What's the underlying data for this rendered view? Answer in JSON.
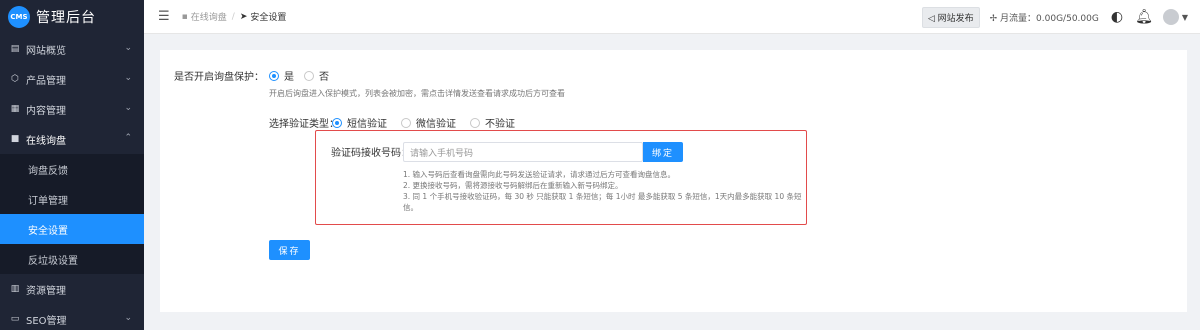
{
  "app": {
    "logo_badge": "CMS",
    "title": "管理后台"
  },
  "sidebar": {
    "items": [
      {
        "label": "网站概览",
        "icon": "dashboard-icon"
      },
      {
        "label": "产品管理",
        "icon": "cube-icon"
      },
      {
        "label": "内容管理",
        "icon": "document-icon"
      },
      {
        "label": "在线询盘",
        "icon": "chat-icon",
        "open": true,
        "children": [
          {
            "label": "询盘反馈"
          },
          {
            "label": "订单管理"
          },
          {
            "label": "安全设置",
            "active": true
          },
          {
            "label": "反垃圾设置"
          }
        ]
      },
      {
        "label": "资源管理",
        "icon": "folder-icon"
      },
      {
        "label": "SEO管理",
        "icon": "seo-icon"
      }
    ]
  },
  "header": {
    "breadcrumb": [
      {
        "label": "在线询盘",
        "icon": "chat-icon"
      },
      {
        "label": "安全设置",
        "icon": "send-icon"
      }
    ],
    "publish_label": "网站发布",
    "traffic_label": "月流量：0.00G/50.00G"
  },
  "form": {
    "protect_label": "是否开启询盘保护：",
    "protect_options": [
      {
        "label": "是",
        "checked": true
      },
      {
        "label": "否",
        "checked": false
      }
    ],
    "protect_hint": "开启后询盘进入保护模式，列表会被加密，需点击详情发送查看请求成功后方可查看",
    "verify_label": "选择验证类型：",
    "verify_options": [
      {
        "label": "短信验证",
        "checked": true
      },
      {
        "label": "微信验证",
        "checked": false
      },
      {
        "label": "不验证",
        "checked": false
      }
    ],
    "phone_label": "验证码接收号码：",
    "phone_placeholder": "请输入手机号码",
    "bind_label": "绑定",
    "notes": [
      "1. 输入号码后查看询盘需向此号码发送验证请求，请求通过后方可查看询盘信息。",
      "2. 更换接收号码，需将源接收号码解绑后在重新输入新号码绑定。",
      "3. 同 1 个手机号接收验证码，每 30 秒 只能获取 1 条短信；每 1小时 最多能获取 5 条短信，1天内最多能获取 10 条短信。"
    ],
    "save_label": "保存"
  },
  "colors": {
    "accent": "#1e90ff",
    "sidebar_bg": "#1f2535",
    "highlight_border": "#e24b4b"
  }
}
